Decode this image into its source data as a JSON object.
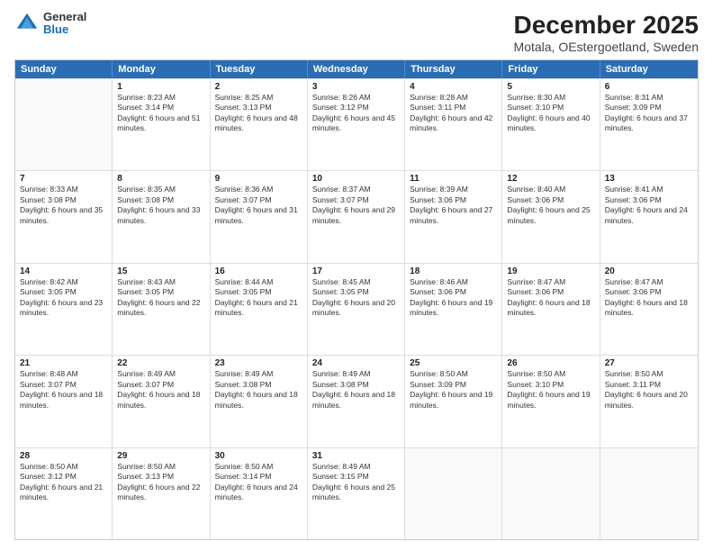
{
  "header": {
    "logo": {
      "general": "General",
      "blue": "Blue"
    },
    "title": "December 2025",
    "subtitle": "Motala, OEstergoetland, Sweden"
  },
  "days_of_week": [
    "Sunday",
    "Monday",
    "Tuesday",
    "Wednesday",
    "Thursday",
    "Friday",
    "Saturday"
  ],
  "weeks": [
    [
      {
        "day": "",
        "sunrise": "",
        "sunset": "",
        "daylight": ""
      },
      {
        "day": "1",
        "sunrise": "Sunrise: 8:23 AM",
        "sunset": "Sunset: 3:14 PM",
        "daylight": "Daylight: 6 hours and 51 minutes."
      },
      {
        "day": "2",
        "sunrise": "Sunrise: 8:25 AM",
        "sunset": "Sunset: 3:13 PM",
        "daylight": "Daylight: 6 hours and 48 minutes."
      },
      {
        "day": "3",
        "sunrise": "Sunrise: 8:26 AM",
        "sunset": "Sunset: 3:12 PM",
        "daylight": "Daylight: 6 hours and 45 minutes."
      },
      {
        "day": "4",
        "sunrise": "Sunrise: 8:28 AM",
        "sunset": "Sunset: 3:11 PM",
        "daylight": "Daylight: 6 hours and 42 minutes."
      },
      {
        "day": "5",
        "sunrise": "Sunrise: 8:30 AM",
        "sunset": "Sunset: 3:10 PM",
        "daylight": "Daylight: 6 hours and 40 minutes."
      },
      {
        "day": "6",
        "sunrise": "Sunrise: 8:31 AM",
        "sunset": "Sunset: 3:09 PM",
        "daylight": "Daylight: 6 hours and 37 minutes."
      }
    ],
    [
      {
        "day": "7",
        "sunrise": "Sunrise: 8:33 AM",
        "sunset": "Sunset: 3:08 PM",
        "daylight": "Daylight: 6 hours and 35 minutes."
      },
      {
        "day": "8",
        "sunrise": "Sunrise: 8:35 AM",
        "sunset": "Sunset: 3:08 PM",
        "daylight": "Daylight: 6 hours and 33 minutes."
      },
      {
        "day": "9",
        "sunrise": "Sunrise: 8:36 AM",
        "sunset": "Sunset: 3:07 PM",
        "daylight": "Daylight: 6 hours and 31 minutes."
      },
      {
        "day": "10",
        "sunrise": "Sunrise: 8:37 AM",
        "sunset": "Sunset: 3:07 PM",
        "daylight": "Daylight: 6 hours and 29 minutes."
      },
      {
        "day": "11",
        "sunrise": "Sunrise: 8:39 AM",
        "sunset": "Sunset: 3:06 PM",
        "daylight": "Daylight: 6 hours and 27 minutes."
      },
      {
        "day": "12",
        "sunrise": "Sunrise: 8:40 AM",
        "sunset": "Sunset: 3:06 PM",
        "daylight": "Daylight: 6 hours and 25 minutes."
      },
      {
        "day": "13",
        "sunrise": "Sunrise: 8:41 AM",
        "sunset": "Sunset: 3:06 PM",
        "daylight": "Daylight: 6 hours and 24 minutes."
      }
    ],
    [
      {
        "day": "14",
        "sunrise": "Sunrise: 8:42 AM",
        "sunset": "Sunset: 3:05 PM",
        "daylight": "Daylight: 6 hours and 23 minutes."
      },
      {
        "day": "15",
        "sunrise": "Sunrise: 8:43 AM",
        "sunset": "Sunset: 3:05 PM",
        "daylight": "Daylight: 6 hours and 22 minutes."
      },
      {
        "day": "16",
        "sunrise": "Sunrise: 8:44 AM",
        "sunset": "Sunset: 3:05 PM",
        "daylight": "Daylight: 6 hours and 21 minutes."
      },
      {
        "day": "17",
        "sunrise": "Sunrise: 8:45 AM",
        "sunset": "Sunset: 3:05 PM",
        "daylight": "Daylight: 6 hours and 20 minutes."
      },
      {
        "day": "18",
        "sunrise": "Sunrise: 8:46 AM",
        "sunset": "Sunset: 3:06 PM",
        "daylight": "Daylight: 6 hours and 19 minutes."
      },
      {
        "day": "19",
        "sunrise": "Sunrise: 8:47 AM",
        "sunset": "Sunset: 3:06 PM",
        "daylight": "Daylight: 6 hours and 18 minutes."
      },
      {
        "day": "20",
        "sunrise": "Sunrise: 8:47 AM",
        "sunset": "Sunset: 3:06 PM",
        "daylight": "Daylight: 6 hours and 18 minutes."
      }
    ],
    [
      {
        "day": "21",
        "sunrise": "Sunrise: 8:48 AM",
        "sunset": "Sunset: 3:07 PM",
        "daylight": "Daylight: 6 hours and 18 minutes."
      },
      {
        "day": "22",
        "sunrise": "Sunrise: 8:49 AM",
        "sunset": "Sunset: 3:07 PM",
        "daylight": "Daylight: 6 hours and 18 minutes."
      },
      {
        "day": "23",
        "sunrise": "Sunrise: 8:49 AM",
        "sunset": "Sunset: 3:08 PM",
        "daylight": "Daylight: 6 hours and 18 minutes."
      },
      {
        "day": "24",
        "sunrise": "Sunrise: 8:49 AM",
        "sunset": "Sunset: 3:08 PM",
        "daylight": "Daylight: 6 hours and 18 minutes."
      },
      {
        "day": "25",
        "sunrise": "Sunrise: 8:50 AM",
        "sunset": "Sunset: 3:09 PM",
        "daylight": "Daylight: 6 hours and 19 minutes."
      },
      {
        "day": "26",
        "sunrise": "Sunrise: 8:50 AM",
        "sunset": "Sunset: 3:10 PM",
        "daylight": "Daylight: 6 hours and 19 minutes."
      },
      {
        "day": "27",
        "sunrise": "Sunrise: 8:50 AM",
        "sunset": "Sunset: 3:11 PM",
        "daylight": "Daylight: 6 hours and 20 minutes."
      }
    ],
    [
      {
        "day": "28",
        "sunrise": "Sunrise: 8:50 AM",
        "sunset": "Sunset: 3:12 PM",
        "daylight": "Daylight: 6 hours and 21 minutes."
      },
      {
        "day": "29",
        "sunrise": "Sunrise: 8:50 AM",
        "sunset": "Sunset: 3:13 PM",
        "daylight": "Daylight: 6 hours and 22 minutes."
      },
      {
        "day": "30",
        "sunrise": "Sunrise: 8:50 AM",
        "sunset": "Sunset: 3:14 PM",
        "daylight": "Daylight: 6 hours and 24 minutes."
      },
      {
        "day": "31",
        "sunrise": "Sunrise: 8:49 AM",
        "sunset": "Sunset: 3:15 PM",
        "daylight": "Daylight: 6 hours and 25 minutes."
      },
      {
        "day": "",
        "sunrise": "",
        "sunset": "",
        "daylight": ""
      },
      {
        "day": "",
        "sunrise": "",
        "sunset": "",
        "daylight": ""
      },
      {
        "day": "",
        "sunrise": "",
        "sunset": "",
        "daylight": ""
      }
    ]
  ]
}
